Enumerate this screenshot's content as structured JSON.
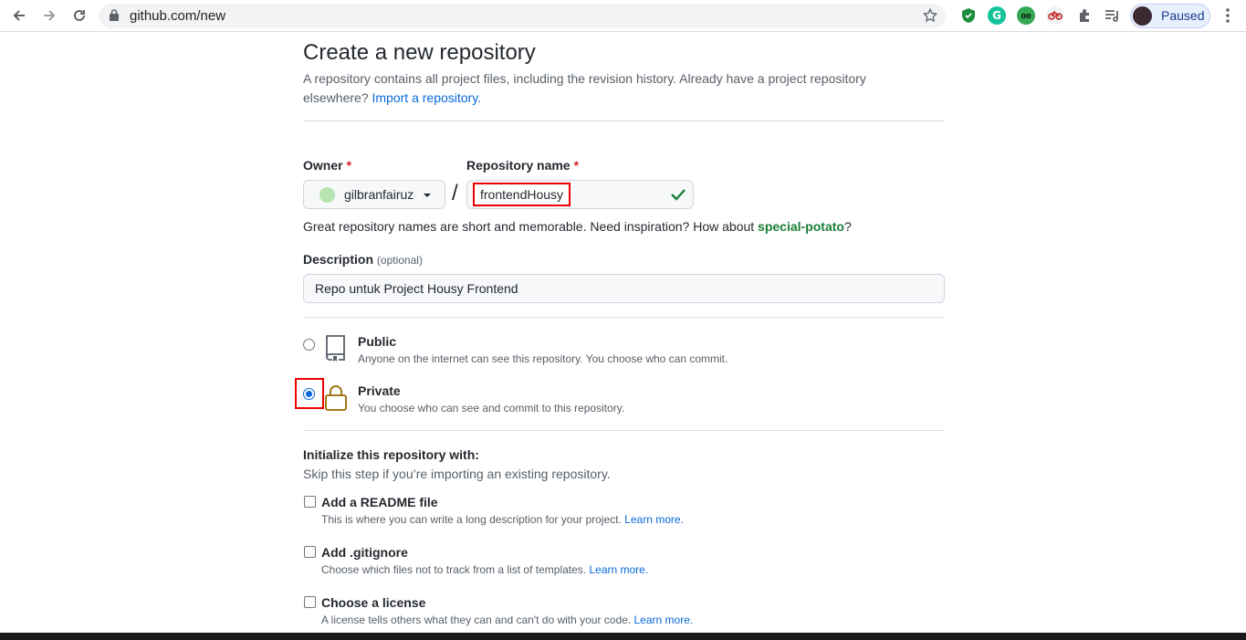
{
  "browser": {
    "url": "github.com/new",
    "profile_label": "Paused"
  },
  "page": {
    "title": "Create a new repository",
    "subtitle_text": "A repository contains all project files, including the revision history. Already have a project repository elsewhere?",
    "import_link": "Import a repository.",
    "owner_label": "Owner",
    "required_mark": "*",
    "owner_value": "gilbranfairuz",
    "slash": "/",
    "repo_label": "Repository name",
    "repo_value": "frontendHousy",
    "hint_prefix": "Great repository names are short and memorable. Need inspiration? How about",
    "hint_suggestion": "special-potato",
    "hint_suffix": "?",
    "description_label": "Description",
    "description_optional": "(optional)",
    "description_value": "Repo untuk Project Housy Frontend",
    "visibility": {
      "public_title": "Public",
      "public_desc": "Anyone on the internet can see this repository. You choose who can commit.",
      "private_title": "Private",
      "private_desc": "You choose who can see and commit to this repository."
    },
    "init_title": "Initialize this repository with:",
    "init_subtitle": "Skip this step if you’re importing an existing repository.",
    "options": [
      {
        "title": "Add a README file",
        "desc": "This is where you can write a long description for your project.",
        "link": "Learn more."
      },
      {
        "title": "Add .gitignore",
        "desc": "Choose which files not to track from a list of templates.",
        "link": "Learn more."
      },
      {
        "title": "Choose a license",
        "desc": "A license tells others what they can and can't do with your code.",
        "link": "Learn more."
      }
    ]
  },
  "colors": {
    "accent": "#0969da",
    "success": "#1a7f37",
    "highlight": "#ee0000"
  }
}
